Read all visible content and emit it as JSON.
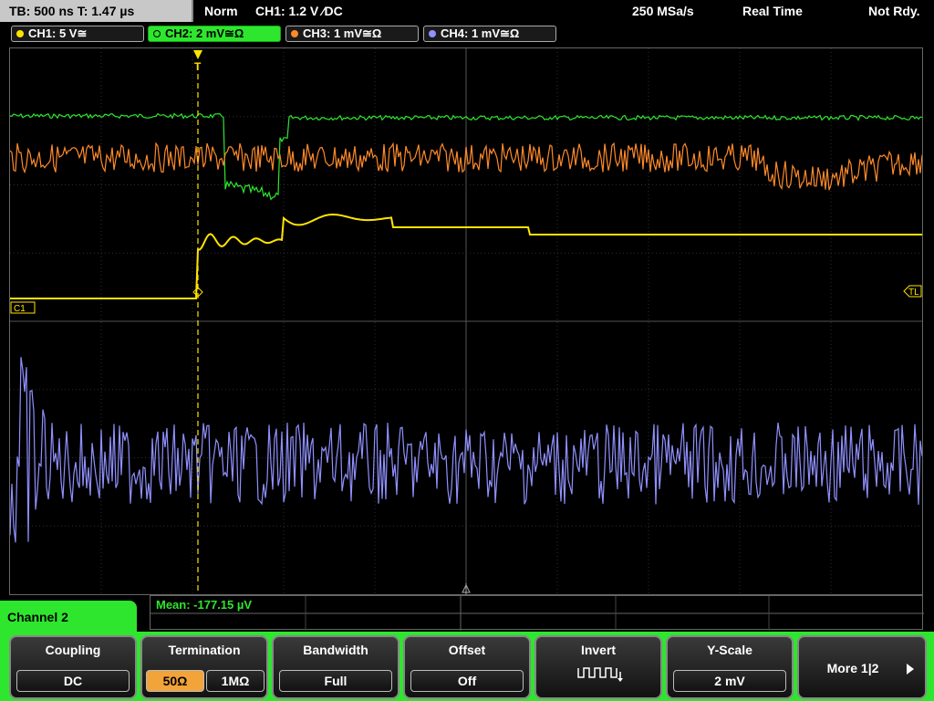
{
  "topbar": {
    "timebase": "TB: 500 ns   T: 1.47 µs",
    "mode": "Norm",
    "trigger": "CH1: 1.2 V ⁄DC",
    "sample_rate": "250 MSa/s",
    "acq_mode": "Real Time",
    "status": "Not Rdy."
  },
  "channels": [
    {
      "label": "CH1: 5 V≅",
      "color": "#ffe400"
    },
    {
      "label": "CH2: 2 mV≅Ω",
      "color": "#2ee62e"
    },
    {
      "label": "CH3: 1 mV≅Ω",
      "color": "#ff8a2a"
    },
    {
      "label": "CH4: 1 mV≅Ω",
      "color": "#9090ff"
    }
  ],
  "markers": {
    "c1": "C1",
    "tl": "TL"
  },
  "measurement": {
    "mean": "Mean: -177.15 µV"
  },
  "menu": {
    "title": "Channel 2",
    "coupling": {
      "title": "Coupling",
      "value": "DC"
    },
    "termination": {
      "title": "Termination",
      "opt1": "50Ω",
      "opt2": "1MΩ",
      "selected": "50Ω"
    },
    "bandwidth": {
      "title": "Bandwidth",
      "value": "Full"
    },
    "offset": {
      "title": "Offset",
      "value": "Off"
    },
    "invert": {
      "title": "Invert"
    },
    "yscale": {
      "title": "Y-Scale",
      "value": "2 mV"
    },
    "more": {
      "label": "More 1|2"
    }
  },
  "colors": {
    "ch1": "#ffe400",
    "ch2": "#2ee62e",
    "ch3": "#ff8a2a",
    "ch4": "#9090ff",
    "grid": "#3a3a3a"
  }
}
